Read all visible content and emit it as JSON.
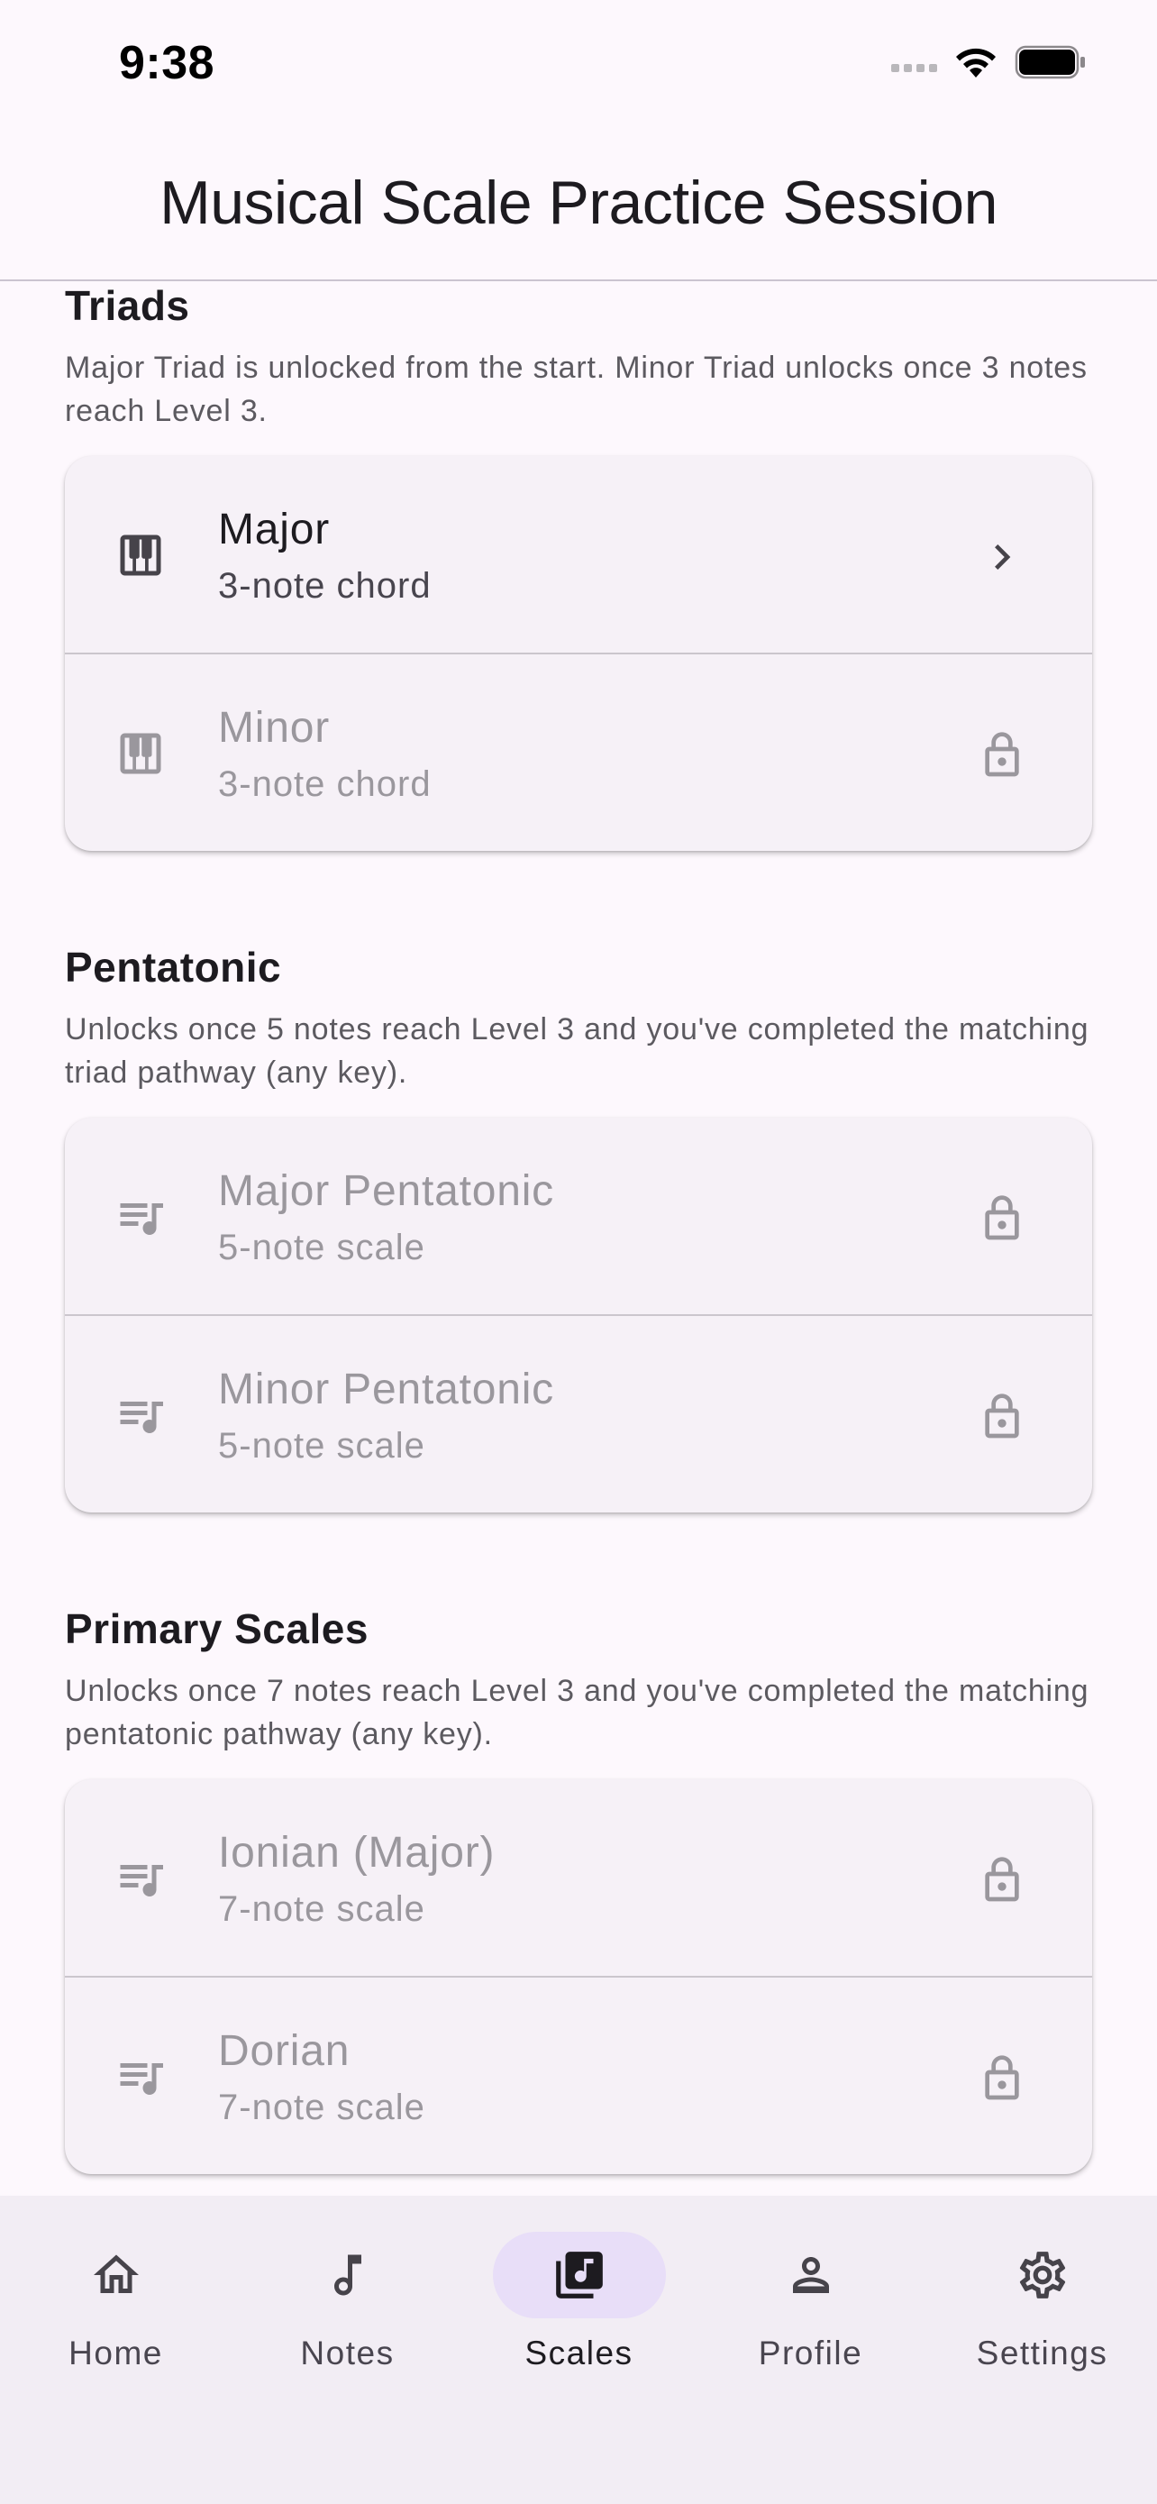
{
  "status_bar": {
    "time": "9:38"
  },
  "header": {
    "title": "Musical Scale Practice Session"
  },
  "sections": [
    {
      "title": "Triads",
      "description": "Major Triad is unlocked from the start. Minor Triad unlocks once 3 notes reach Level 3.",
      "items": [
        {
          "title": "Major",
          "subtitle": "3-note chord",
          "icon": "piano-icon",
          "state": "unlocked",
          "trailing": "chevron-right-icon"
        },
        {
          "title": "Minor",
          "subtitle": "3-note chord",
          "icon": "piano-icon",
          "state": "locked",
          "trailing": "lock-icon"
        }
      ]
    },
    {
      "title": "Pentatonic",
      "description": "Unlocks once 5 notes reach Level 3 and you've completed the matching triad pathway (any key).",
      "items": [
        {
          "title": "Major Pentatonic",
          "subtitle": "5-note scale",
          "icon": "queue-music-icon",
          "state": "locked",
          "trailing": "lock-icon"
        },
        {
          "title": "Minor Pentatonic",
          "subtitle": "5-note scale",
          "icon": "queue-music-icon",
          "state": "locked",
          "trailing": "lock-icon"
        }
      ]
    },
    {
      "title": "Primary Scales",
      "description": "Unlocks once 7 notes reach Level 3 and you've completed the matching pentatonic pathway (any key).",
      "items": [
        {
          "title": "Ionian (Major)",
          "subtitle": "7-note scale",
          "icon": "queue-music-icon",
          "state": "locked",
          "trailing": "lock-icon"
        },
        {
          "title": "Dorian",
          "subtitle": "7-note scale",
          "icon": "queue-music-icon",
          "state": "locked",
          "trailing": "lock-icon"
        }
      ]
    }
  ],
  "bottom_nav": {
    "selected": "Scales",
    "items": [
      {
        "label": "Home",
        "icon": "home-icon"
      },
      {
        "label": "Notes",
        "icon": "music-note-icon"
      },
      {
        "label": "Scales",
        "icon": "library-music-icon"
      },
      {
        "label": "Profile",
        "icon": "person-icon"
      },
      {
        "label": "Settings",
        "icon": "gear-icon"
      }
    ]
  },
  "colors": {
    "background": "#fdf8fd",
    "card": "#f6f1f7",
    "nav_background": "#f2edf4",
    "nav_selected_pill": "#e8def8",
    "text_primary": "#1d1b20",
    "text_disabled": "#9a979d"
  }
}
